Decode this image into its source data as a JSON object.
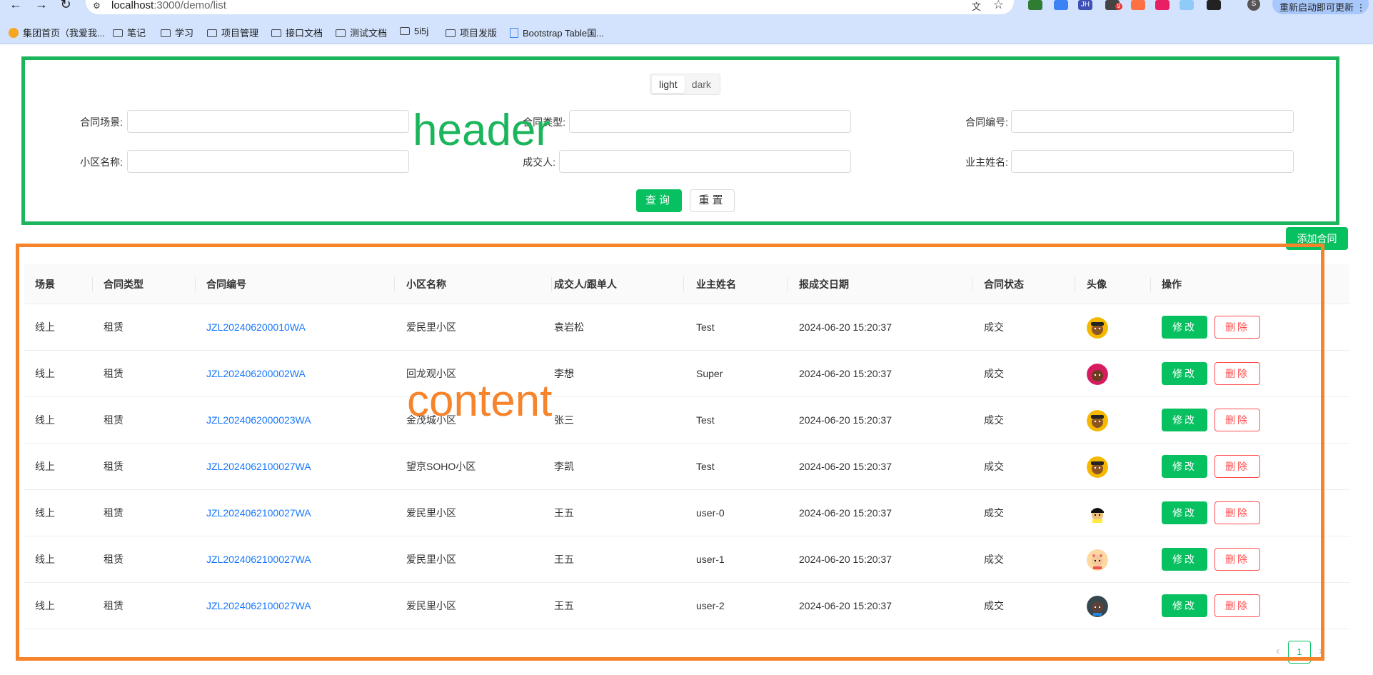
{
  "browser": {
    "url_host": "localhost",
    "url_rest": ":3000/demo/list",
    "update_label": "重新启动即可更新",
    "profile_initial": "S",
    "ext_badge": "9",
    "ext_jh": "JH",
    "bookmarks": [
      {
        "label": "集团首页（我爱我...",
        "icon": "home-favicon"
      },
      {
        "label": "笔记",
        "icon": "folder-icon"
      },
      {
        "label": "学习",
        "icon": "folder-icon"
      },
      {
        "label": "项目管理",
        "icon": "folder-icon"
      },
      {
        "label": "接口文档",
        "icon": "folder-icon"
      },
      {
        "label": "测试文档",
        "icon": "folder-icon"
      },
      {
        "label": "5i5j",
        "icon": "folder-icon"
      },
      {
        "label": "项目发版",
        "icon": "folder-icon"
      },
      {
        "label": "Bootstrap Table国...",
        "icon": "doc-favicon"
      }
    ]
  },
  "annotations": {
    "header": "header",
    "content": "content",
    "header_color": "#1bb55c",
    "content_color": "#f5842c"
  },
  "theme": {
    "light": "light",
    "dark": "dark",
    "selected": "light"
  },
  "search_form": {
    "contract_scene_label": "合同场景:",
    "contract_type_label": "合同类型:",
    "contract_no_label": "合同编号:",
    "community_label": "小区名称:",
    "dealer_label": "成交人:",
    "owner_label": "业主姓名:",
    "query_button": "查询",
    "reset_button": "重置"
  },
  "add_button": "添加合同",
  "accent_color": "#07c160",
  "table": {
    "columns": [
      "场景",
      "合同类型",
      "合同编号",
      "小区名称",
      "成交人/跟单人",
      "业主姓名",
      "报成交日期",
      "合同状态",
      "头像",
      "操作"
    ],
    "edit_label": "修改",
    "delete_label": "删除",
    "rows": [
      {
        "scene": "线上",
        "type": "租赁",
        "no": "JZL202406200010WA",
        "community": "爱民里小区",
        "dealer": "袁岩松",
        "owner": "Test",
        "date": "2024-06-20 15:20:37",
        "status": "成交",
        "avatar": "avatar-yellow-hat"
      },
      {
        "scene": "线上",
        "type": "租赁",
        "no": "JZL202406200002WA",
        "community": "回龙观小区",
        "dealer": "李想",
        "owner": "Super",
        "date": "2024-06-20 15:20:37",
        "status": "成交",
        "avatar": "avatar-pink"
      },
      {
        "scene": "线上",
        "type": "租赁",
        "no": "JZL2024062000023WA",
        "community": "金茂城小区",
        "dealer": "张三",
        "owner": "Test",
        "date": "2024-06-20 15:20:37",
        "status": "成交",
        "avatar": "avatar-yellow-hat"
      },
      {
        "scene": "线上",
        "type": "租赁",
        "no": "JZL2024062100027WA",
        "community": "望京SOHO小区",
        "dealer": "李凯",
        "owner": "Test",
        "date": "2024-06-20 15:20:37",
        "status": "成交",
        "avatar": "avatar-yellow-hat"
      },
      {
        "scene": "线上",
        "type": "租赁",
        "no": "JZL2024062100027WA",
        "community": "爱民里小区",
        "dealer": "王五",
        "owner": "user-0",
        "date": "2024-06-20 15:20:37",
        "status": "成交",
        "avatar": "avatar-black-hair"
      },
      {
        "scene": "线上",
        "type": "租赁",
        "no": "JZL2024062100027WA",
        "community": "爱民里小区",
        "dealer": "王五",
        "owner": "user-1",
        "date": "2024-06-20 15:20:37",
        "status": "成交",
        "avatar": "avatar-baby"
      },
      {
        "scene": "线上",
        "type": "租赁",
        "no": "JZL2024062100027WA",
        "community": "爱民里小区",
        "dealer": "王五",
        "owner": "user-2",
        "date": "2024-06-20 15:20:37",
        "status": "成交",
        "avatar": "avatar-dark"
      }
    ]
  },
  "pagination": {
    "current": "1",
    "prev_icon": "‹",
    "next_icon": "›"
  }
}
